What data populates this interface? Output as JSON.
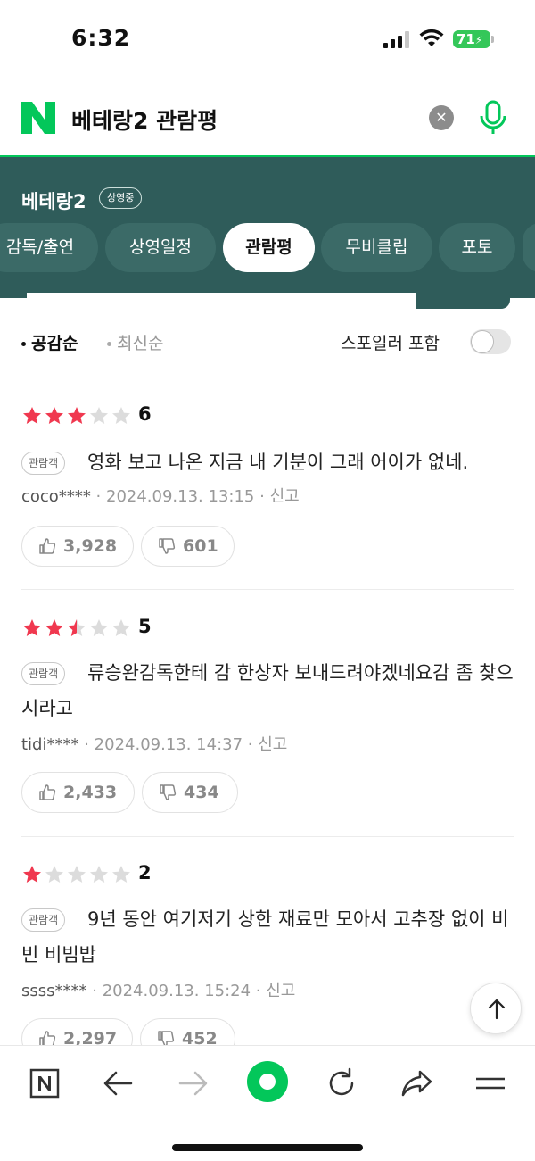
{
  "status_bar": {
    "time": "6:32",
    "battery": "71"
  },
  "search": {
    "query": "베테랑2 관람평",
    "clear_icon": "close-icon",
    "voice_icon": "mic-icon",
    "accent_color": "#03c75a"
  },
  "movie": {
    "title": "베테랑2",
    "badge": "상영중",
    "header_color": "#2f5c5a",
    "tabs": [
      {
        "label": "감독/출연",
        "active": false
      },
      {
        "label": "상영일정",
        "active": false
      },
      {
        "label": "관람평",
        "active": true
      },
      {
        "label": "무비클립",
        "active": false
      },
      {
        "label": "포토",
        "active": false
      }
    ]
  },
  "sort": {
    "options": [
      {
        "label": "공감순",
        "active": true
      },
      {
        "label": "최신순",
        "active": false
      }
    ],
    "spoiler_label": "스포일러 포함",
    "spoiler_enabled": false
  },
  "reviews": [
    {
      "rating": 3,
      "score": "6",
      "badge": "관람객",
      "text": "영화 보고 나온 지금 내 기분이 그래 어이가 없네.",
      "user": "coco****",
      "date": "2024.09.13. 13:15",
      "report": "신고",
      "likes": "3,928",
      "dislikes": "601"
    },
    {
      "rating": 2.5,
      "score": "5",
      "badge": "관람객",
      "text": "류승완감독한테 감 한상자 보내드려야겠네요감 좀 찾으시라고",
      "user": "tidi****",
      "date": "2024.09.13. 14:37",
      "report": "신고",
      "likes": "2,433",
      "dislikes": "434"
    },
    {
      "rating": 1,
      "score": "2",
      "badge": "관람객",
      "text": "9년 동안 여기저기 상한 재료만 모아서 고추장 없이 비빈 비빔밥",
      "user": "ssss****",
      "date": "2024.09.13. 15:24",
      "report": "신고",
      "likes": "2,297",
      "dislikes": "452"
    }
  ],
  "icons": {
    "like": "thumbs-up-icon",
    "dislike": "thumbs-down-icon",
    "scroll_top": "arrow-up-icon"
  },
  "bottom_nav": [
    {
      "icon": "naver-home-icon"
    },
    {
      "icon": "back-arrow-icon"
    },
    {
      "icon": "forward-arrow-icon"
    },
    {
      "icon": "green-dot-icon"
    },
    {
      "icon": "refresh-icon"
    },
    {
      "icon": "share-icon"
    },
    {
      "icon": "menu-icon"
    }
  ],
  "star_colors": {
    "filled": "#f0384f",
    "empty": "#dcdcdc"
  }
}
